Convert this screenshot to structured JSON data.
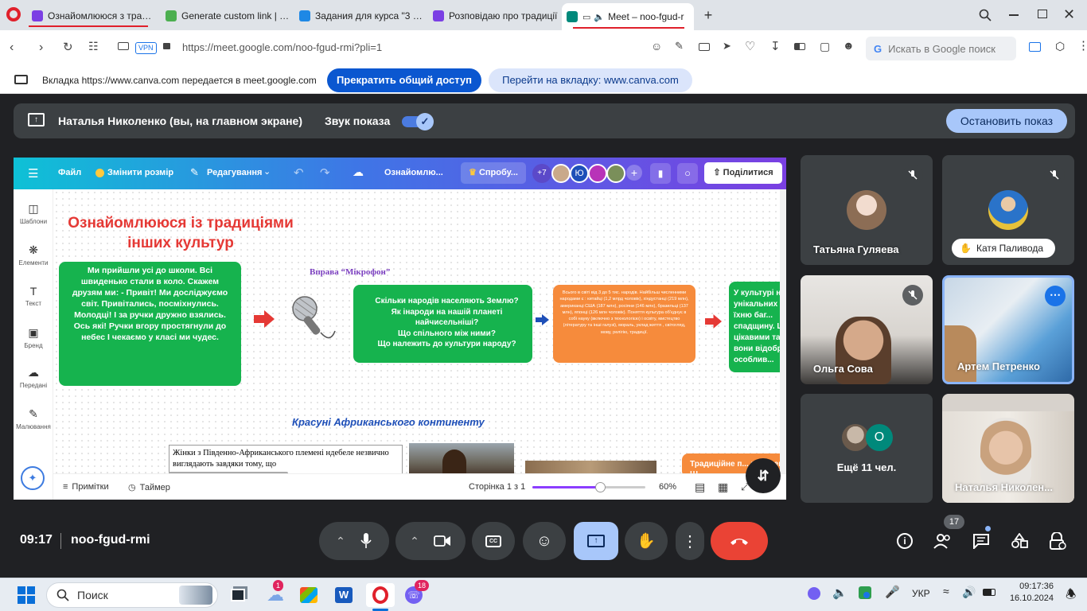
{
  "browser": {
    "tabs": [
      {
        "title": "Ознайомлююся з традиц",
        "favicon_color": "#7b3fe4",
        "active": false
      },
      {
        "title": "Generate custom link | Liv",
        "favicon_color": "#4caf50",
        "active": false
      },
      {
        "title": "Задания для курса \"3 кла",
        "favicon_color": "#1e88e5",
        "active": false
      },
      {
        "title": "Розповідаю про традиції",
        "favicon_color": "#7b3fe4",
        "active": false
      },
      {
        "title": "Meet – noo-fgud-r",
        "favicon_color": "#00897b",
        "active": true
      }
    ],
    "vpn_label": "VPN",
    "url": "https://meet.google.com/noo-fgud-rmi?pli=1",
    "search_placeholder": "Искать в Google поиск",
    "share_notice": "Вкладка https://www.canva.com передается в meet.google.com",
    "stop_share_button": "Прекратить общий доступ",
    "goto_tab_button": "Перейти на вкладку: www.canva.com",
    "brand_color": "#e0202b"
  },
  "meet": {
    "presenter_label": "Наталья Николенко (вы, на главном экране)",
    "audio_label": "Звук показа",
    "stop_presenting_button": "Остановить показ",
    "time": "09:17",
    "meeting_code": "noo-fgud-rmi",
    "people_count": "17",
    "end_call_color": "#ea4335",
    "accent_color": "#8ab4f8",
    "participants": [
      {
        "name": "Татьяна Гуляева",
        "muted": true
      },
      {
        "name": "Катя Паливода",
        "muted": true
      },
      {
        "name": "Ольга Сова",
        "muted": true
      },
      {
        "name": "Артем Петренко",
        "muted": false
      },
      {
        "name": "Ещё 11 чел.",
        "avatar_letter": "О"
      },
      {
        "name": "Наталья Николен..."
      }
    ]
  },
  "canva": {
    "menu": {
      "file": "Файл",
      "resize": "Змінити розмір",
      "edit": "Редагування",
      "doc_title": "Ознайомлю...",
      "try": "Спробу...",
      "more_collaborators": "+7",
      "collab_letter": "Ю",
      "share": "Поділитися"
    },
    "sidebar": [
      "Шаблони",
      "Елементи",
      "Текст",
      "Бренд",
      "Передані",
      "Малювання"
    ],
    "slide": {
      "title_line1": "Ознайомлююся із традиціями",
      "title_line2": "інших культур",
      "poem": "Ми прийшли усі до школи. Всі швиденько стали в коло. Скажем друзям ми: - Привіт! Ми досліджуємо світ. Привітались, посміхнулись. Молодці! І за ручки дружно взялись. Ось які! Ручки вгору простягнули до небес І чекаємо у класі ми чудес.",
      "exercise_label": "Вправа “Мікрофон”",
      "questions": [
        "Скільки народів населяють Землю?",
        "Як інароди на нашій планеті найчисельніші?",
        "Що спільного між ними?",
        "Що належить до культури народу?"
      ],
      "facts_text": "Всього в світі від 3 до 5 тис. народів. Найбільш численними народами є : китайці (1,2 млрд чоловік), хіндустанці (219 млн), американці США (187 млн), росіяни (146 млн), бразильці (137 млн), японці (126 млн чоловік). Поняття культура об'єднує в собі науку (включно з технологією) і освіту, мистецтво (літературу та інші галузі), мораль, уклад життя , світогляд, мову, релігію, традиції.",
      "culture_text": "У культурі н... унікальних з... їхню баг... спадщину. Ц... цікавими та ... вони відобра... особлив...",
      "africa_heading": "Красуні Африканського континенту",
      "africa_text": "Жінки з Південно-Африканського племені ндебеле незвично виглядають завдяки тому, що",
      "traditions_text": "Традиційне п... королеви. Ш..."
    },
    "footer": {
      "notes": "Примітки",
      "timer": "Таймер",
      "page": "Сторінка 1 з 1",
      "zoom": "60%",
      "zoom_fraction": 0.6
    }
  },
  "taskbar": {
    "search": "Поиск",
    "language": "УКР",
    "clock_time": "09:17:36",
    "clock_date": "16.10.2024",
    "badge_onedrive": "1",
    "badge_viber": "18"
  }
}
